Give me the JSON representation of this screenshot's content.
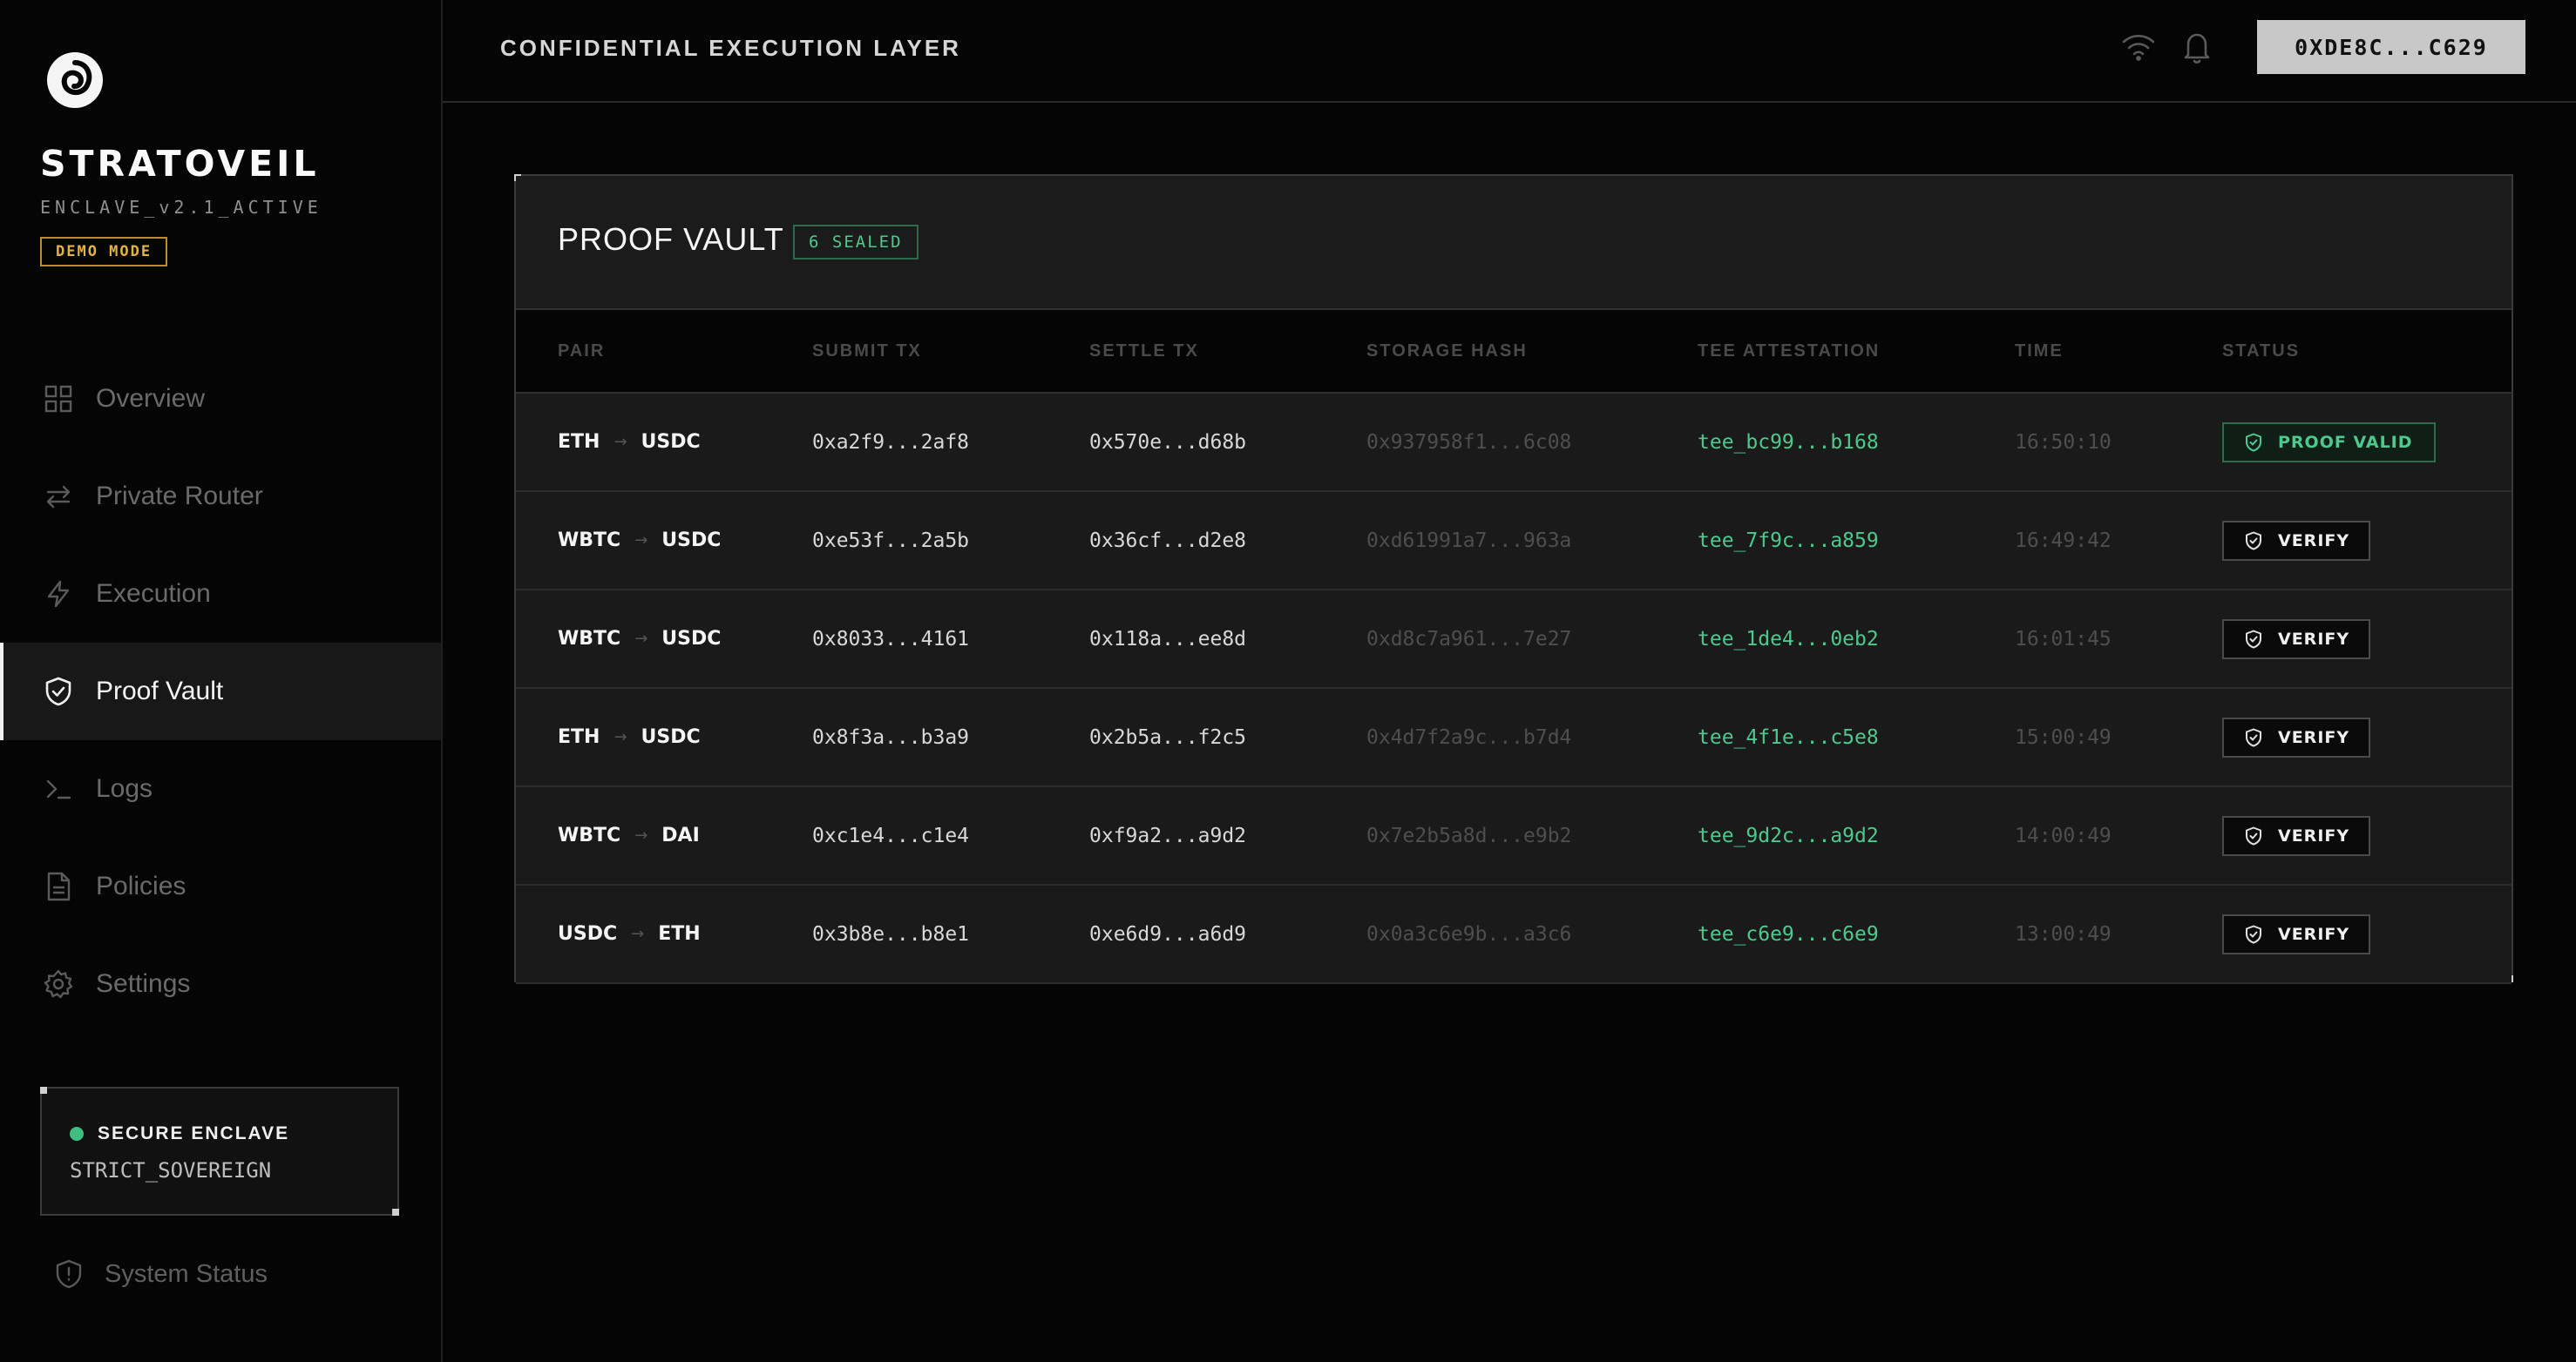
{
  "sidebar": {
    "brand": "STRATOVEIL",
    "version": "ENCLAVE_v2.1_ACTIVE",
    "demo_badge": "DEMO MODE",
    "nav": [
      {
        "label": "Overview",
        "icon": "grid-icon",
        "active": false
      },
      {
        "label": "Private Router",
        "icon": "swap-arrows-icon",
        "active": false
      },
      {
        "label": "Execution",
        "icon": "lightning-icon",
        "active": false
      },
      {
        "label": "Proof Vault",
        "icon": "shield-check-icon",
        "active": true
      },
      {
        "label": "Logs",
        "icon": "terminal-icon",
        "active": false
      },
      {
        "label": "Policies",
        "icon": "document-icon",
        "active": false
      },
      {
        "label": "Settings",
        "icon": "gear-icon",
        "active": false
      }
    ],
    "enclave": {
      "title": "SECURE ENCLAVE",
      "mode": "STRICT_SOVEREIGN",
      "status_color": "#3fbf7f"
    },
    "system_status": "System Status"
  },
  "header": {
    "title": "CONFIDENTIAL EXECUTION LAYER",
    "wallet": "0XDE8C...C629"
  },
  "vault": {
    "title": "PROOF VAULT",
    "sealed_badge": "6 SEALED",
    "columns": [
      "PAIR",
      "SUBMIT TX",
      "SETTLE TX",
      "STORAGE HASH",
      "TEE ATTESTATION",
      "TIME",
      "STATUS"
    ],
    "rows": [
      {
        "from": "ETH",
        "to": "USDC",
        "submit": "0xa2f9...2af8",
        "settle": "0x570e...d68b",
        "hash": "0x937958f1...6c08",
        "tee": "tee_bc99...b168",
        "time": "16:50:10",
        "status": "PROOF VALID",
        "valid": true
      },
      {
        "from": "WBTC",
        "to": "USDC",
        "submit": "0xe53f...2a5b",
        "settle": "0x36cf...d2e8",
        "hash": "0xd61991a7...963a",
        "tee": "tee_7f9c...a859",
        "time": "16:49:42",
        "status": "VERIFY",
        "valid": false
      },
      {
        "from": "WBTC",
        "to": "USDC",
        "submit": "0x8033...4161",
        "settle": "0x118a...ee8d",
        "hash": "0xd8c7a961...7e27",
        "tee": "tee_1de4...0eb2",
        "time": "16:01:45",
        "status": "VERIFY",
        "valid": false
      },
      {
        "from": "ETH",
        "to": "USDC",
        "submit": "0x8f3a...b3a9",
        "settle": "0x2b5a...f2c5",
        "hash": "0x4d7f2a9c...b7d4",
        "tee": "tee_4f1e...c5e8",
        "time": "15:00:49",
        "status": "VERIFY",
        "valid": false
      },
      {
        "from": "WBTC",
        "to": "DAI",
        "submit": "0xc1e4...c1e4",
        "settle": "0xf9a2...a9d2",
        "hash": "0x7e2b5a8d...e9b2",
        "tee": "tee_9d2c...a9d2",
        "time": "14:00:49",
        "status": "VERIFY",
        "valid": false
      },
      {
        "from": "USDC",
        "to": "ETH",
        "submit": "0x3b8e...b8e1",
        "settle": "0xe6d9...a6d9",
        "hash": "0x0a3c6e9b...a3c6",
        "tee": "tee_c6e9...c6e9",
        "time": "13:00:49",
        "status": "VERIFY",
        "valid": false
      }
    ]
  },
  "colors": {
    "accent_green": "#4ec98d",
    "warning_gold": "#e3b341",
    "background": "#050505"
  }
}
